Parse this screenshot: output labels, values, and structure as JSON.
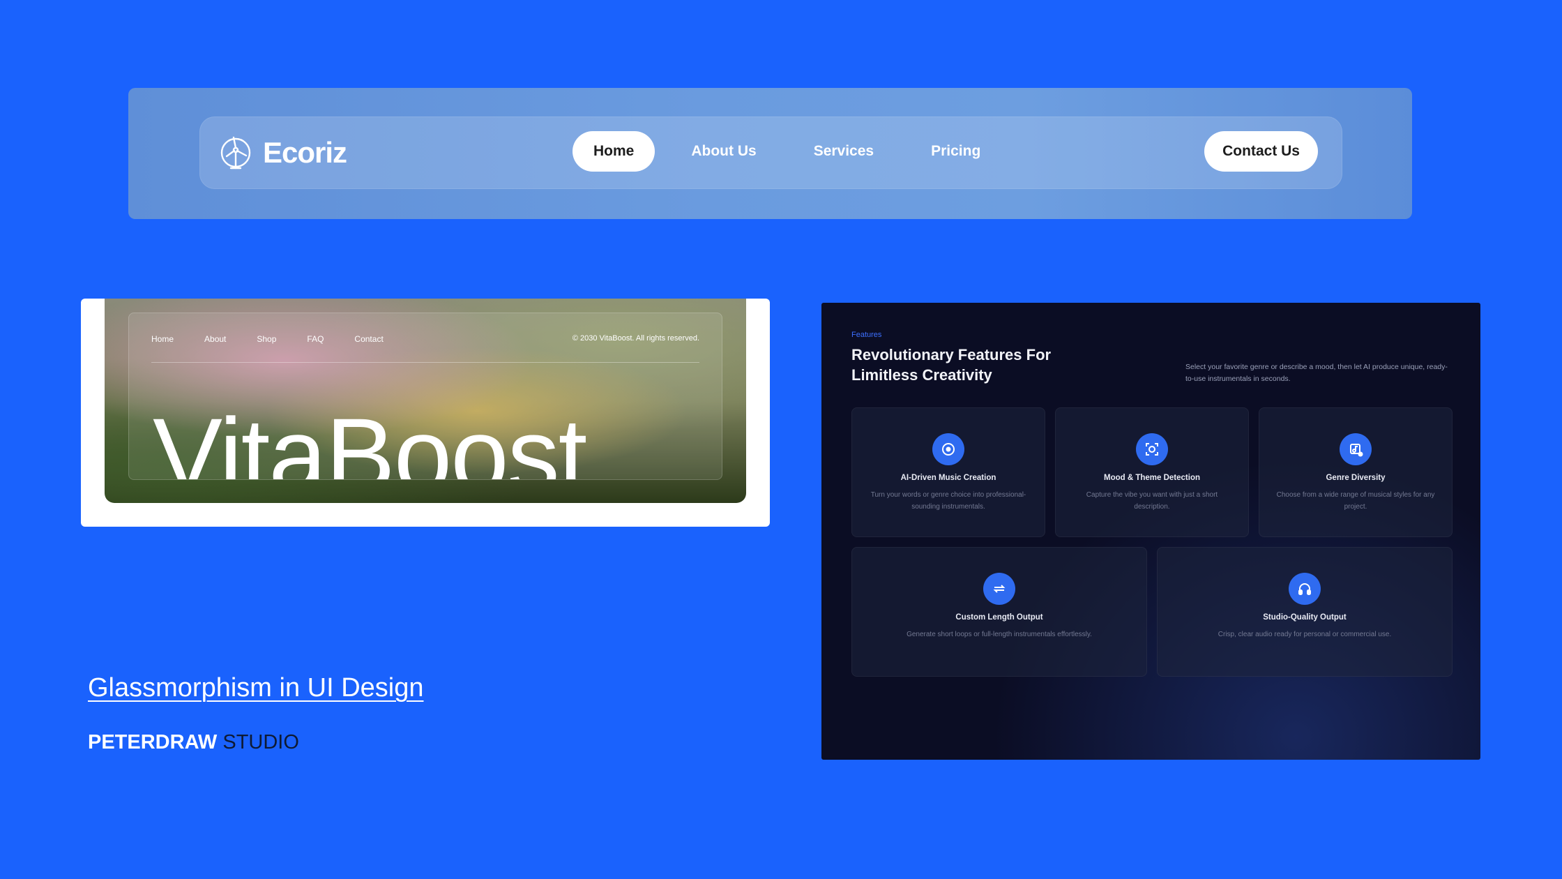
{
  "navbar": {
    "brand": "Ecoriz",
    "links": [
      "Home",
      "About Us",
      "Services",
      "Pricing"
    ],
    "active": "Home",
    "contact": "Contact Us"
  },
  "vitaboost": {
    "nav": [
      "Home",
      "About",
      "Shop",
      "FAQ",
      "Contact"
    ],
    "copyright": "© 2030 VitaBoost. All rights reserved.",
    "title": "VitaBoost"
  },
  "headline": "Glassmorphism in UI Design",
  "studio": {
    "bold": "PETERDRAW",
    "thin": "STUDIO"
  },
  "features": {
    "eyebrow": "Features",
    "title": "Revolutionary Features For Limitless Creativity",
    "description": "Select your favorite genre or describe a mood, then let AI produce unique, ready-to-use instrumentals in seconds.",
    "items": [
      {
        "title": "AI-Driven Music Creation",
        "desc": "Turn your words or genre choice into professional-sounding instrumentals.",
        "icon": "disc-icon"
      },
      {
        "title": "Mood & Theme Detection",
        "desc": "Capture the vibe you want with just a short description.",
        "icon": "scan-face-icon"
      },
      {
        "title": "Genre Diversity",
        "desc": "Choose from a wide range of musical styles for any project.",
        "icon": "music-library-icon"
      },
      {
        "title": "Custom Length Output",
        "desc": "Generate short loops or full-length instrumentals effortlessly.",
        "icon": "repeat-icon"
      },
      {
        "title": "Studio-Quality Output",
        "desc": "Crisp, clear audio ready for personal or commercial use.",
        "icon": "headphones-icon"
      }
    ]
  },
  "colors": {
    "background": "#1a62fd",
    "accent": "#2f6bf0",
    "panel": "#0b0d24"
  }
}
